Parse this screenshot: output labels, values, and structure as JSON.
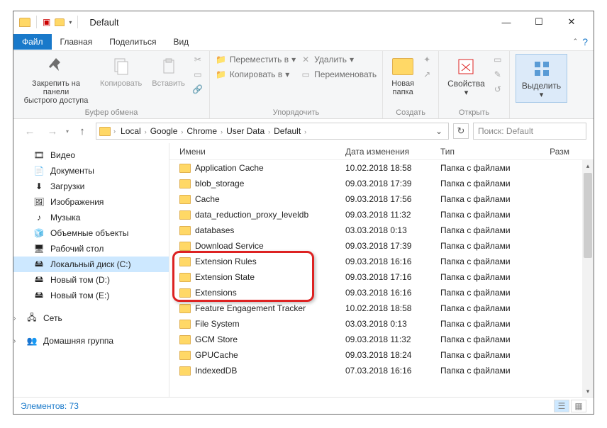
{
  "title": "Default",
  "tabs": {
    "file": "Файл",
    "home": "Главная",
    "share": "Поделиться",
    "view": "Вид"
  },
  "ribbon": {
    "pin": "Закрепить на панели\nбыстрого доступа",
    "copy": "Копировать",
    "paste": "Вставить",
    "clipboard_group": "Буфер обмена",
    "move_to": "Переместить в",
    "copy_to": "Копировать в",
    "delete": "Удалить",
    "rename": "Переименовать",
    "organize_group": "Упорядочить",
    "new_folder": "Новая\nпапка",
    "create_group": "Создать",
    "properties": "Свойства",
    "open_group": "Открыть",
    "select": "Выделить"
  },
  "breadcrumb": [
    "Local",
    "Google",
    "Chrome",
    "User Data",
    "Default"
  ],
  "search_placeholder": "Поиск: Default",
  "nav": [
    {
      "label": "Видео",
      "type": "video"
    },
    {
      "label": "Документы",
      "type": "doc"
    },
    {
      "label": "Загрузки",
      "type": "download"
    },
    {
      "label": "Изображения",
      "type": "image"
    },
    {
      "label": "Музыка",
      "type": "music"
    },
    {
      "label": "Объемные объекты",
      "type": "3d"
    },
    {
      "label": "Рабочий стол",
      "type": "desktop"
    },
    {
      "label": "Локальный диск (C:)",
      "type": "drive",
      "selected": true
    },
    {
      "label": "Новый том (D:)",
      "type": "drive"
    },
    {
      "label": "Новый том (E:)",
      "type": "drive"
    }
  ],
  "nav_network": "Сеть",
  "nav_homegroup": "Домашняя группа",
  "columns": {
    "name": "Имени",
    "date": "Дата изменения",
    "type": "Тип",
    "size": "Разм"
  },
  "folder_type": "Папка с файлами",
  "files": [
    {
      "name": "Application Cache",
      "date": "10.02.2018 18:58"
    },
    {
      "name": "blob_storage",
      "date": "09.03.2018 17:39"
    },
    {
      "name": "Cache",
      "date": "09.03.2018 17:56"
    },
    {
      "name": "data_reduction_proxy_leveldb",
      "date": "09.03.2018 11:32"
    },
    {
      "name": "databases",
      "date": "03.03.2018 0:13"
    },
    {
      "name": "Download Service",
      "date": "09.03.2018 17:39"
    },
    {
      "name": "Extension Rules",
      "date": "09.03.2018 16:16",
      "hl": true
    },
    {
      "name": "Extension State",
      "date": "09.03.2018 17:16",
      "hl": true
    },
    {
      "name": "Extensions",
      "date": "09.03.2018 16:16",
      "hl": true
    },
    {
      "name": "Feature Engagement Tracker",
      "date": "10.02.2018 18:58"
    },
    {
      "name": "File System",
      "date": "03.03.2018 0:13"
    },
    {
      "name": "GCM Store",
      "date": "09.03.2018 11:32"
    },
    {
      "name": "GPUCache",
      "date": "09.03.2018 18:24"
    },
    {
      "name": "IndexedDB",
      "date": "07.03.2018 16:16"
    }
  ],
  "status": "Элементов: 73"
}
